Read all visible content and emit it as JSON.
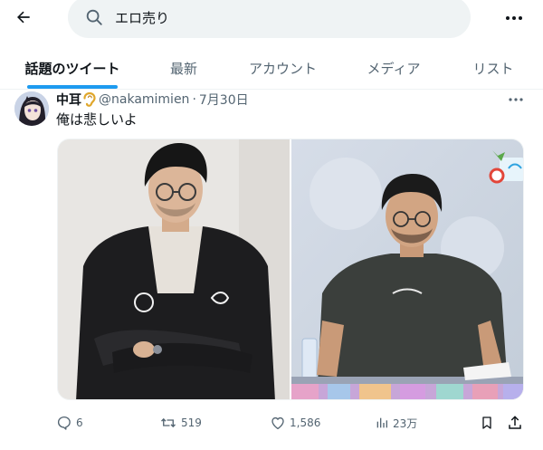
{
  "search": {
    "query": "エロ売り"
  },
  "tabs": [
    {
      "label": "話題のツイート",
      "active": true
    },
    {
      "label": "最新"
    },
    {
      "label": "アカウント"
    },
    {
      "label": "メディア"
    },
    {
      "label": "リスト"
    }
  ],
  "tweet": {
    "display_name": "中耳",
    "name_emoji_icon": "ear-icon",
    "handle": "@nakamimien",
    "separator": "·",
    "date": "7月30日",
    "text": "俺は悲しいよ",
    "photos": [
      {
        "icon": "photo-man-black-jacket"
      },
      {
        "icon": "photo-man-grey-tshirt-stage"
      }
    ],
    "stats": {
      "replies": "6",
      "retweets": "519",
      "likes": "1,586",
      "views": "23万"
    }
  },
  "colors": {
    "accent": "#1d9bf0",
    "text_primary": "#0f1419",
    "text_secondary": "#536471",
    "search_bg": "#eff3f4"
  }
}
